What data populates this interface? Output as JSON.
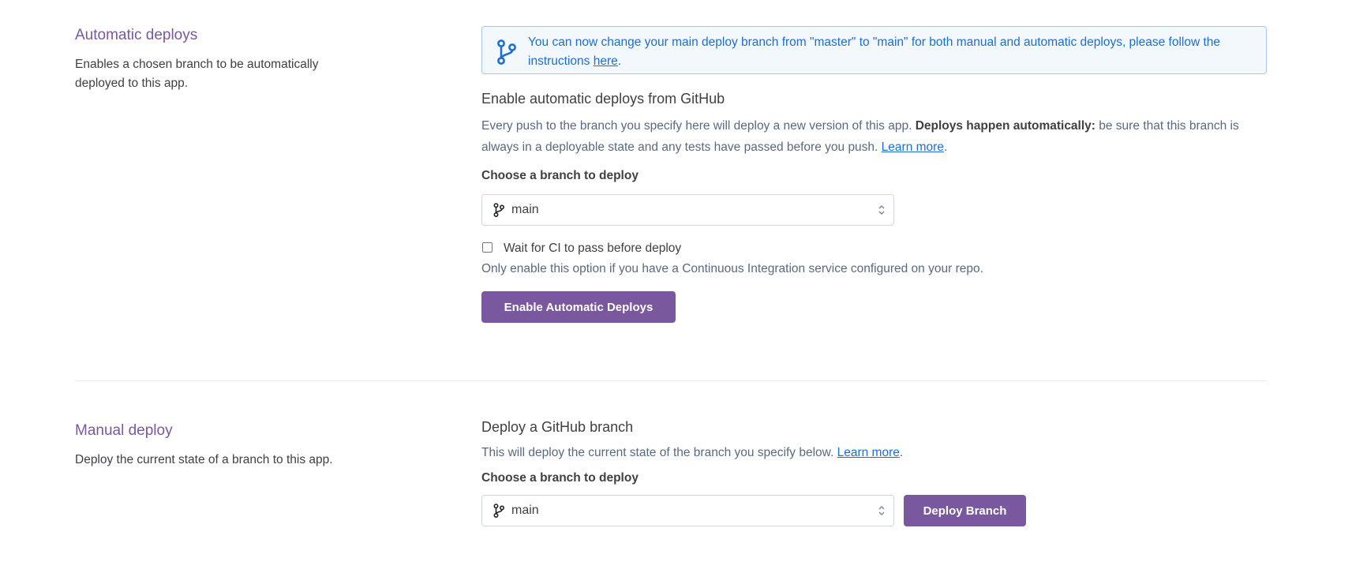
{
  "automatic": {
    "title": "Automatic deploys",
    "description": "Enables a chosen branch to be automatically deployed to this app.",
    "info": {
      "text_before": "You can now change your main deploy branch from \"master\" to \"main\" for both manual and automatic deploys, please follow the instructions ",
      "link": "here",
      "text_after": "."
    },
    "heading": "Enable automatic deploys from GitHub",
    "paragraph": {
      "text_before": "Every push to the branch you specify here will deploy a new version of this app. ",
      "bold": "Deploys happen automatically:",
      "text_after": " be sure that this branch is always in a deployable state and any tests have passed before you push. ",
      "link": "Learn more",
      "end": "."
    },
    "branch_label": "Choose a branch to deploy",
    "branch_value": "main",
    "ci_checkbox": {
      "label": "Wait for CI to pass before deploy",
      "checked": false
    },
    "ci_note": "Only enable this option if you have a Continuous Integration service configured on your repo.",
    "button": "Enable Automatic Deploys"
  },
  "manual": {
    "title": "Manual deploy",
    "description": "Deploy the current state of a branch to this app.",
    "heading": "Deploy a GitHub branch",
    "paragraph": {
      "text_before": "This will deploy the current state of the branch you specify below. ",
      "link": "Learn more",
      "end": "."
    },
    "branch_label": "Choose a branch to deploy",
    "branch_value": "main",
    "button": "Deploy Branch"
  },
  "colors": {
    "accent": "#79589f",
    "link": "#1a6fd4",
    "info_border": "#a9c7ea",
    "info_bg": "#f3f8fd"
  },
  "icons": [
    "git-branch-icon",
    "chevron-up-down-icon"
  ]
}
